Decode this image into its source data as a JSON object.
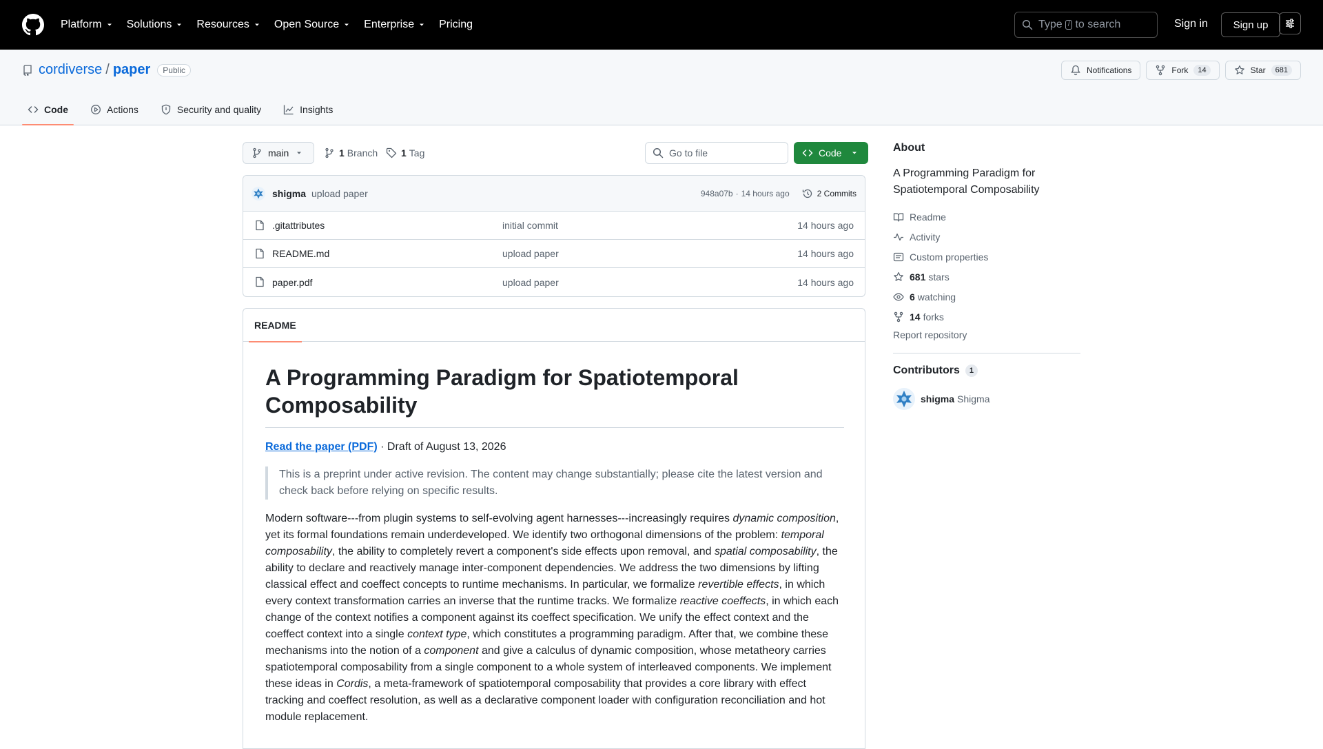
{
  "header": {
    "nav": [
      {
        "label": "Platform",
        "dropdown": true
      },
      {
        "label": "Solutions",
        "dropdown": true
      },
      {
        "label": "Resources",
        "dropdown": true
      },
      {
        "label": "Open Source",
        "dropdown": true
      },
      {
        "label": "Enterprise",
        "dropdown": true
      },
      {
        "label": "Pricing",
        "dropdown": false
      }
    ],
    "search_pre": "Type",
    "search_key": "/",
    "search_post": "to search",
    "sign_in": "Sign in",
    "sign_up": "Sign up"
  },
  "repo": {
    "owner": "cordiverse",
    "separator": "/",
    "name": "paper",
    "visibility": "Public",
    "notifications_label": "Notifications",
    "fork_label": "Fork",
    "fork_count": "14",
    "star_label": "Star",
    "star_count": "681",
    "tabs": [
      {
        "label": "Code",
        "icon": "code-icon",
        "active": true
      },
      {
        "label": "Actions",
        "icon": "play-icon",
        "active": false
      },
      {
        "label": "Security and quality",
        "icon": "shield-icon",
        "active": false
      },
      {
        "label": "Insights",
        "icon": "graph-icon",
        "active": false
      }
    ]
  },
  "toolbar": {
    "branch": "main",
    "branches_count": "1",
    "branches_label": "Branch",
    "tags_count": "1",
    "tags_label": "Tag",
    "goto_placeholder": "Go to file",
    "code_label": "Code"
  },
  "commit": {
    "author": "shigma",
    "message": "upload paper",
    "hash": "948a07b",
    "sep": "·",
    "age": "14 hours ago",
    "commits_label": "2 Commits"
  },
  "files": [
    {
      "name": ".gitattributes",
      "message": "initial commit",
      "age": "14 hours ago"
    },
    {
      "name": "README.md",
      "message": "upload paper",
      "age": "14 hours ago"
    },
    {
      "name": "paper.pdf",
      "message": "upload paper",
      "age": "14 hours ago"
    }
  ],
  "readme": {
    "tab": "README",
    "title": "A Programming Paradigm for Spatiotemporal Composability",
    "pdf_link": "Read the paper (PDF)",
    "draft": " · Draft of August 13, 2026",
    "quote": "This is a preprint under active revision. The content may change substantially; please cite the latest version and check back before relying on specific results.",
    "abstract_parts": [
      {
        "t": "Modern software---from plugin systems to self-evolving agent harnesses---increasingly requires ",
        "i": false
      },
      {
        "t": "dynamic composition",
        "i": true
      },
      {
        "t": ", yet its formal foundations remain underdeveloped. We identify two orthogonal dimensions of the problem: ",
        "i": false
      },
      {
        "t": "temporal composability",
        "i": true
      },
      {
        "t": ", the ability to completely revert a component's side effects upon removal, and ",
        "i": false
      },
      {
        "t": "spatial composability",
        "i": true
      },
      {
        "t": ", the ability to declare and reactively manage inter-component dependencies. We address the two dimensions by lifting classical effect and coeffect concepts to runtime mechanisms. In particular, we formalize ",
        "i": false
      },
      {
        "t": "revertible effects",
        "i": true
      },
      {
        "t": ", in which every context transformation carries an inverse that the runtime tracks. We formalize ",
        "i": false
      },
      {
        "t": "reactive coeffects",
        "i": true
      },
      {
        "t": ", in which each change of the context notifies a component against its coeffect specification. We unify the effect context and the coeffect context into a single ",
        "i": false
      },
      {
        "t": "context type",
        "i": true
      },
      {
        "t": ", which constitutes a programming paradigm. After that, we combine these mechanisms into the notion of a ",
        "i": false
      },
      {
        "t": "component",
        "i": true
      },
      {
        "t": " and give a calculus of dynamic composition, whose metatheory carries spatiotemporal composability from a single component to a whole system of interleaved components. We implement these ideas in ",
        "i": false
      },
      {
        "t": "Cordis",
        "i": true
      },
      {
        "t": ", a meta-framework of spatiotemporal composability that provides a core library with effect tracking and coeffect resolution, as well as a declarative component loader with configuration reconciliation and hot module replacement.",
        "i": false
      }
    ]
  },
  "sidebar": {
    "about_title": "About",
    "description": "A Programming Paradigm for Spatiotemporal Composability",
    "links": [
      {
        "icon": "book-icon",
        "bold": "",
        "label": "Readme"
      },
      {
        "icon": "pulse-icon",
        "bold": "",
        "label": "Activity"
      },
      {
        "icon": "note-icon",
        "bold": "",
        "label": "Custom properties"
      },
      {
        "icon": "star-icon",
        "bold": "681",
        "label": "stars"
      },
      {
        "icon": "eye-icon",
        "bold": "6",
        "label": "watching"
      },
      {
        "icon": "fork-icon",
        "bold": "14",
        "label": "forks"
      }
    ],
    "report": "Report repository",
    "contributors_title": "Contributors",
    "contributors_count": "1",
    "contributor_login": "shigma",
    "contributor_name": "Shigma"
  },
  "colors": {
    "link": "#0969da",
    "accent_underline": "#fd8c73",
    "code_button": "#1f883d"
  }
}
